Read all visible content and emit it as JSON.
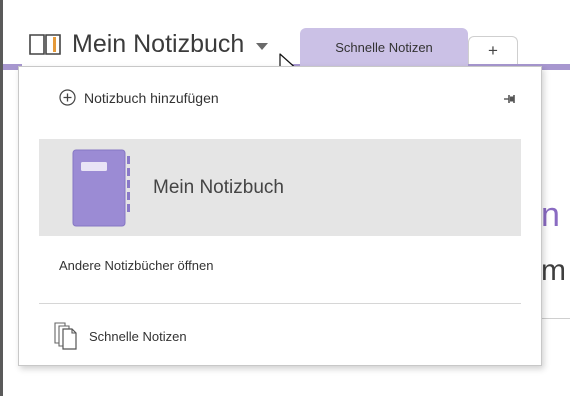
{
  "header": {
    "notebook_title": "Mein Notizbuch",
    "tabs": [
      {
        "label": "Schnelle Notizen"
      },
      {
        "label": "+"
      }
    ]
  },
  "dropdown": {
    "add_notebook_label": "Notizbuch hinzufügen",
    "notebooks": [
      {
        "label": "Mein Notizbuch"
      }
    ],
    "open_other_label": "Andere Notizbücher öffnen",
    "quick_notes_label": "Schnelle Notizen"
  },
  "background": {
    "fragment1": "n",
    "fragment2": "m"
  },
  "icons": {
    "notebook": "notebook-icon",
    "add": "plus-circle-icon",
    "pin": "pin-icon",
    "quick_notes": "pages-icon"
  },
  "colors": {
    "accent": "#a797cf",
    "tab": "#cbc1e6",
    "selected_item_bg": "#e5e5e5",
    "notebook_cover": "#9b8bd4"
  }
}
